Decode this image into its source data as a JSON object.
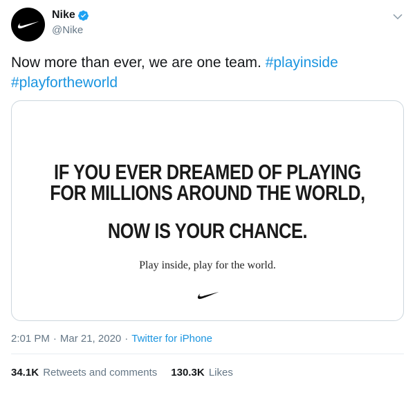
{
  "author": {
    "display_name": "Nike",
    "handle": "@Nike",
    "verified": true,
    "avatar_icon": "nike-swoosh-icon"
  },
  "tweet": {
    "text_plain": "Now more than ever, we are one team.",
    "hashtags": [
      "#playinside",
      "#playfortheworld"
    ]
  },
  "media": {
    "headline_line1": "IF YOU EVER DREAMED OF PLAYING",
    "headline_line2": "FOR MILLIONS AROUND THE WORLD,",
    "headline_line3": "NOW IS YOUR CHANCE.",
    "tagline": "Play inside, play for the world."
  },
  "meta": {
    "time": "2:01 PM",
    "separator": "·",
    "date": "Mar 21, 2020",
    "source": "Twitter for iPhone"
  },
  "stats": {
    "retweets_count": "34.1K",
    "retweets_label": "Retweets and comments",
    "likes_count": "130.3K",
    "likes_label": "Likes"
  },
  "colors": {
    "link": "#1b95e0",
    "text": "#14171a",
    "secondary": "#657786",
    "border": "#ccd6dd",
    "verified": "#1da1f2"
  }
}
